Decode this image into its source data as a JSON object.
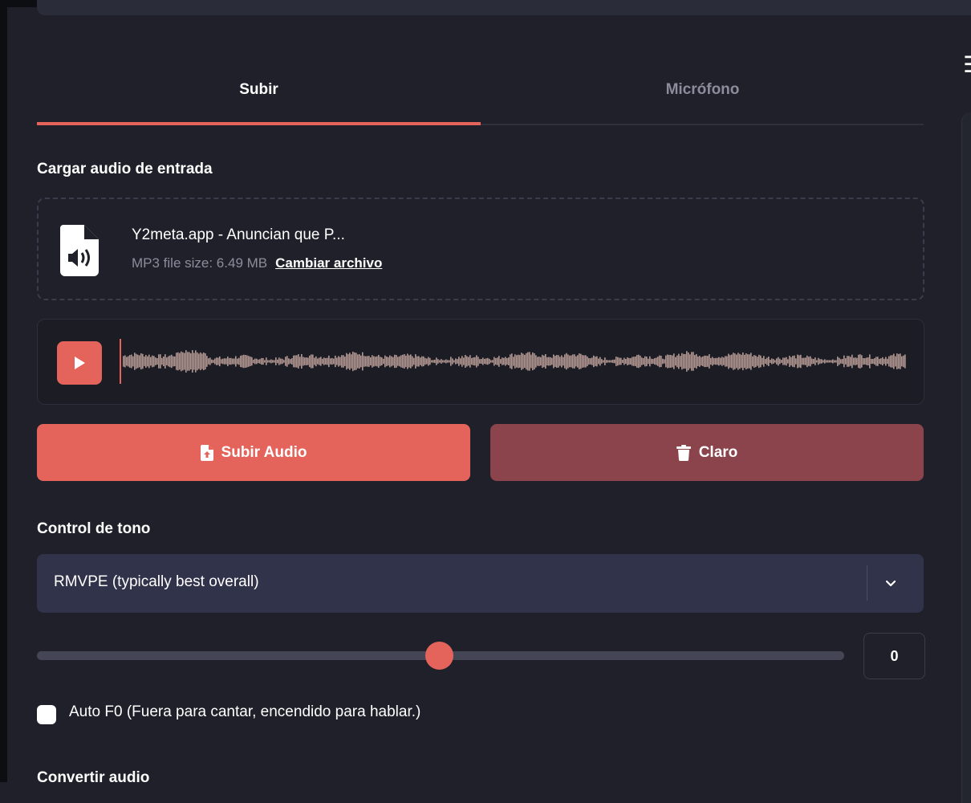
{
  "tabs": {
    "upload": "Subir",
    "microphone": "Micrófono"
  },
  "upload_section": {
    "label": "Cargar audio de entrada",
    "file_name": "Y2meta.app - Anuncian que P...",
    "file_meta": "MP3 file size: 6.49 MB",
    "change_file": "Cambiar archivo"
  },
  "buttons": {
    "upload_audio": "Subir Audio",
    "clear": "Claro"
  },
  "pitch": {
    "label": "Control de tono",
    "selected": "RMVPE (typically best overall)",
    "value": "0"
  },
  "auto_f0": {
    "label": "Auto F0 (Fuera para cantar, encendido para hablar.)",
    "checked": false
  },
  "next_section": {
    "label": "Convertir audio"
  },
  "colors": {
    "accent": "#e4645c",
    "clear_button": "#8b434c",
    "background": "#1f2029",
    "waveform": "#b39793"
  },
  "icons": {
    "file": "audio-file-icon",
    "play": "play-icon",
    "upload": "file-upload-icon",
    "clear": "trash-icon",
    "dropdown": "chevron-down-icon"
  }
}
